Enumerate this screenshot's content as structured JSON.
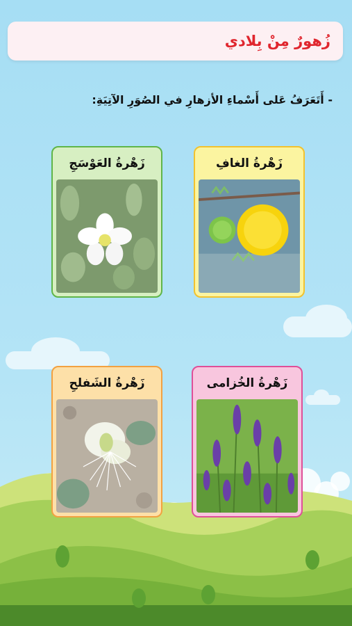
{
  "page": {
    "title": "زُهورٌ مِنْ بِلادي",
    "instruction": "- أَتَعَرَفُ عَلى أَسْماءِ الأزهارِ في الصُوَرِ الآتِيَةِ:"
  },
  "cards": [
    {
      "label": "زَهْرةُ الغافِ",
      "border": "#f2c22e",
      "header_bg": "#fbf4a0",
      "photo": "ghaf yellow pom-pom flower"
    },
    {
      "label": "زَهْرةُ العَوْسَجِ",
      "border": "#5fb548",
      "header_bg": "#d7efc2",
      "photo": "awsaj white star flower"
    },
    {
      "label": "زَهْرةُ الخُزامى",
      "border": "#df4f98",
      "header_bg": "#f8c6de",
      "photo": "lavender purple spikes"
    },
    {
      "label": "زَهْرةُ الشَفلحِ",
      "border": "#f2a141",
      "header_bg": "#fde0a8",
      "photo": "caper white flower"
    }
  ]
}
